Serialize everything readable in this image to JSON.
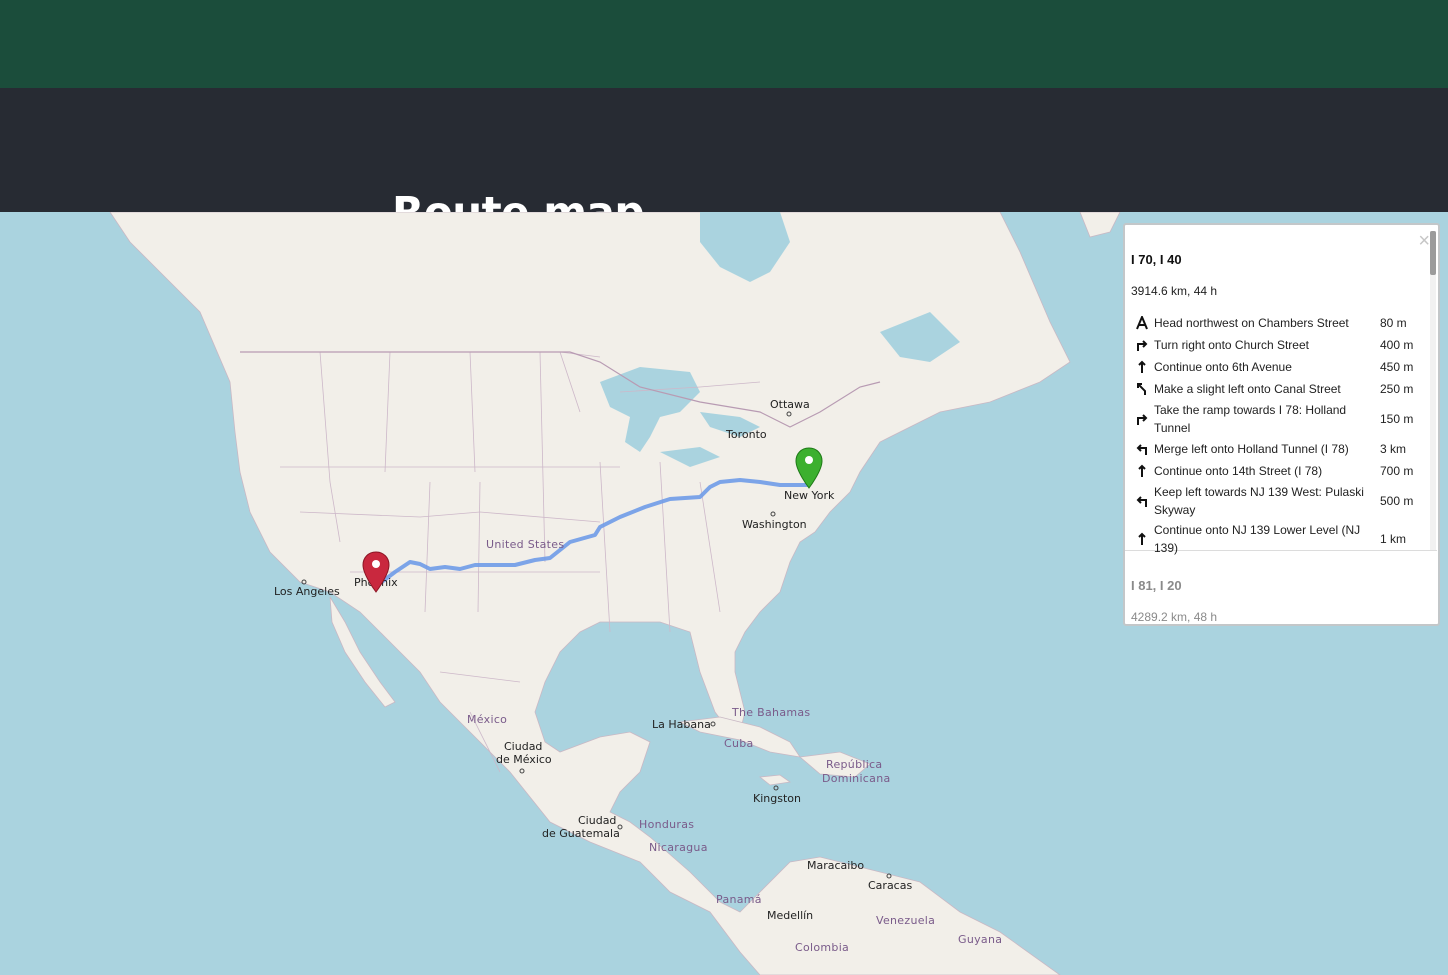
{
  "header": {
    "title": "Route map"
  },
  "map": {
    "labels": {
      "ottawa": "Ottawa",
      "toronto": "Toronto",
      "new_york": "New York",
      "washington": "Washington",
      "united_states": "United States",
      "phoenix": "Phoenix",
      "los_angeles": "Los Angeles",
      "mexico": "México",
      "ciudad_mexico_1": "Ciudad",
      "ciudad_mexico_2": "de México",
      "la_habana": "La Habana",
      "bahamas": "The Bahamas",
      "cuba": "Cuba",
      "republica_1": "República",
      "republica_2": "Dominicana",
      "kingston": "Kingston",
      "guatemala_1": "Ciudad",
      "guatemala_2": "de Guatemala",
      "honduras": "Honduras",
      "nicaragua": "Nicaragua",
      "panama": "Panamá",
      "maracaibo": "Maracaibo",
      "caracas": "Caracas",
      "medellin": "Medellín",
      "venezuela": "Venezuela",
      "colombia": "Colombia",
      "guyana": "Guyana"
    },
    "start_marker": {
      "icon": "green-pin-icon",
      "color": "#3cb02f",
      "place": "New York"
    },
    "end_marker": {
      "icon": "red-pin-icon",
      "color": "#c9283e",
      "place": "Phoenix"
    },
    "route_color": "#6f9be8"
  },
  "panel": {
    "close_label": "×",
    "routes": [
      {
        "name": "I 70, I 40",
        "summary": "3914.6 km, 44 h",
        "steps": [
          {
            "icon": "depart-icon",
            "text": "Head northwest on Chambers Street",
            "distance": "80 m"
          },
          {
            "icon": "turn-right-icon",
            "text": "Turn right onto Church Street",
            "distance": "400 m"
          },
          {
            "icon": "straight-icon",
            "text": "Continue onto 6th Avenue",
            "distance": "450 m"
          },
          {
            "icon": "slight-left-icon",
            "text": "Make a slight left onto Canal Street",
            "distance": "250 m"
          },
          {
            "icon": "turn-right-icon",
            "text": "Take the ramp towards I 78: Holland Tunnel",
            "distance": "150 m"
          },
          {
            "icon": "turn-left-icon",
            "text": "Merge left onto Holland Tunnel (I 78)",
            "distance": "3 km"
          },
          {
            "icon": "straight-icon",
            "text": "Continue onto 14th Street (I 78)",
            "distance": "700 m"
          },
          {
            "icon": "turn-left-icon",
            "text": "Keep left towards NJ 139 West: Pulaski Skyway",
            "distance": "500 m"
          },
          {
            "icon": "straight-icon",
            "text": "Continue onto NJ 139 Lower Level (NJ 139)",
            "distance": "1 km"
          }
        ]
      },
      {
        "name": "I 81, I 20",
        "summary": "4289.2 km, 48 h"
      }
    ]
  }
}
